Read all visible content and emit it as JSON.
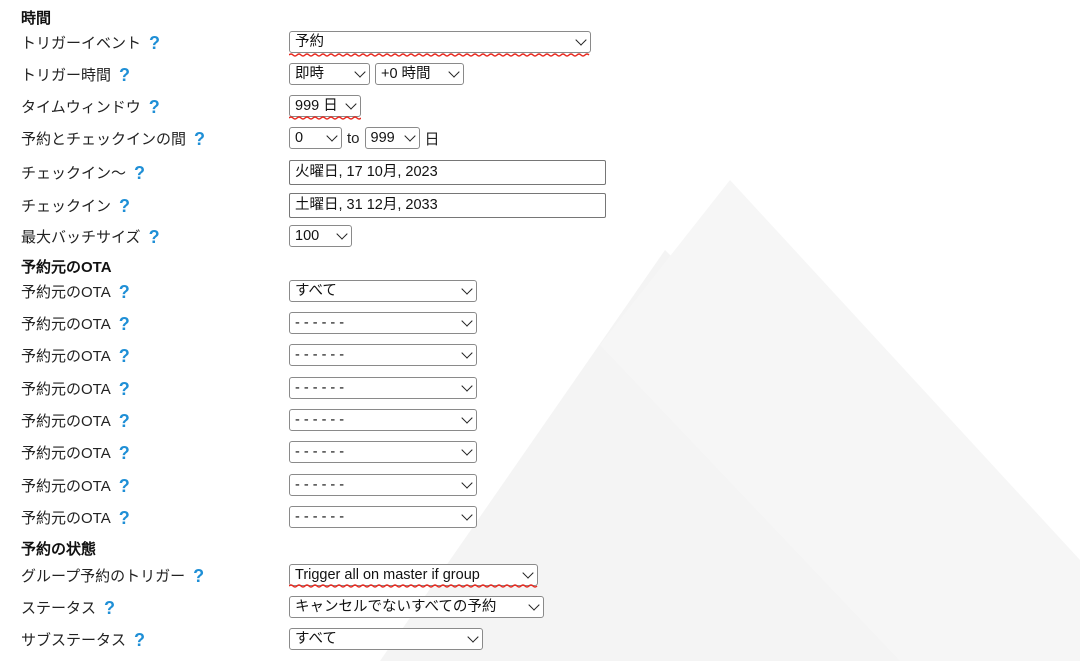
{
  "colors": {
    "help_icon": "#1f8fd6",
    "underline": "#e8281e",
    "watermark": "#f4f4f4"
  },
  "sections": {
    "time": "時間",
    "ota": "予約元のOTA",
    "status": "予約の状態"
  },
  "help_glyph": "?",
  "rows": {
    "trigger_event": {
      "label": "トリガーイベント",
      "value": "予約"
    },
    "trigger_time": {
      "label": "トリガー時間",
      "value": "即時",
      "offset": "+0 時間"
    },
    "time_window": {
      "label": "タイムウィンドウ",
      "value": "999 日"
    },
    "booking_checkin_gap": {
      "label": "予約とチェックインの間",
      "from": "0",
      "to_word": "to",
      "to": "999",
      "unit": "日"
    },
    "checkin_from": {
      "label": "チェックイン〜",
      "value": "火曜日, 17 10月, 2023"
    },
    "checkin_to": {
      "label": "チェックイン",
      "value": "土曜日, 31 12月, 2033"
    },
    "max_batch": {
      "label": "最大バッチサイズ",
      "value": "100"
    },
    "ota": [
      {
        "label": "予約元のOTA",
        "value": "すべて"
      },
      {
        "label": "予約元のOTA",
        "value": "- - - - - -"
      },
      {
        "label": "予約元のOTA",
        "value": "- - - - - -"
      },
      {
        "label": "予約元のOTA",
        "value": "- - - - - -"
      },
      {
        "label": "予約元のOTA",
        "value": "- - - - - -"
      },
      {
        "label": "予約元のOTA",
        "value": "- - - - - -"
      },
      {
        "label": "予約元のOTA",
        "value": "- - - - - -"
      },
      {
        "label": "予約元のOTA",
        "value": "- - - - - -"
      }
    ],
    "group_trigger": {
      "label": "グループ予約のトリガー",
      "value": "Trigger all on master if group"
    },
    "status": {
      "label": "ステータス",
      "value": "キャンセルでないすべての予約"
    },
    "sub_status": {
      "label": "サブステータス",
      "value": "すべて"
    }
  }
}
